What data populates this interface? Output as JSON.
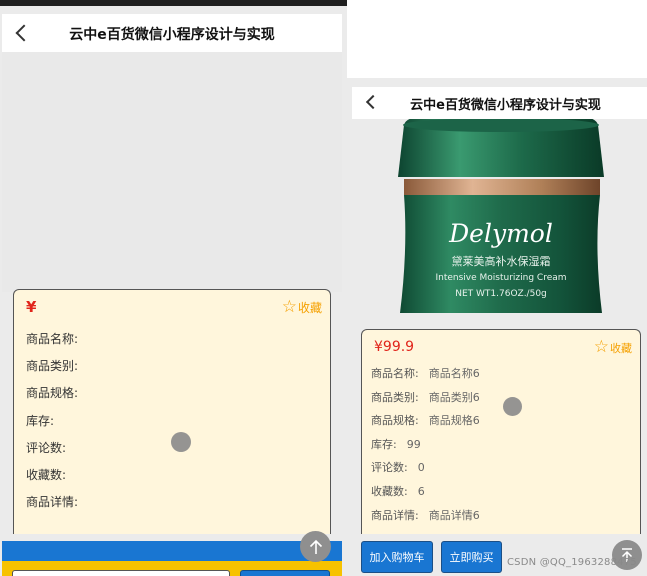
{
  "left": {
    "nav_title": "云中e百货微信小程序设计与实现",
    "price_symbol": "¥",
    "favorite_label": "收藏",
    "fields": [
      "商品名称:",
      "商品类别:",
      "商品规格:",
      "库存:",
      "评论数:",
      "收藏数:",
      "商品详情:"
    ]
  },
  "right": {
    "nav_title": "云中e百货微信小程序设计与实现",
    "product_image": {
      "brand": "Delymol",
      "name_cn": "黛莱美高补水保湿霜",
      "name_en": "Intensive Moisturizing Cream",
      "net_wt": "NET WT1.76OZ./50g"
    },
    "carousel": {
      "count": 3,
      "active": 0
    },
    "price": "¥99.9",
    "favorite_label": "收藏",
    "fields": [
      {
        "label": "商品名称:",
        "value": "商品名称6"
      },
      {
        "label": "商品类别:",
        "value": "商品类别6"
      },
      {
        "label": "商品规格:",
        "value": "商品规格6"
      },
      {
        "label": "库存:",
        "value": "99"
      },
      {
        "label": "评论数:",
        "value": "0"
      },
      {
        "label": "收藏数:",
        "value": "6"
      },
      {
        "label": "商品详情:",
        "value": "商品详情6"
      }
    ],
    "add_to_cart_label": "加入购物车",
    "buy_now_label": "立即购买"
  },
  "watermark": "CSDN @QQ_1963288475",
  "colors": {
    "price": "#e1251b",
    "favorite": "#f5a000",
    "card_bg": "#fff6dc",
    "primary_button": "#1976d2",
    "yellow_bar": "#f7c200",
    "jar_green": "#1f6b4b",
    "jar_gold": "#b08058"
  },
  "icons": {
    "back": "chevron-left-icon",
    "favorite": "star-outline-icon",
    "scroll_top": "arrow-up-icon"
  }
}
